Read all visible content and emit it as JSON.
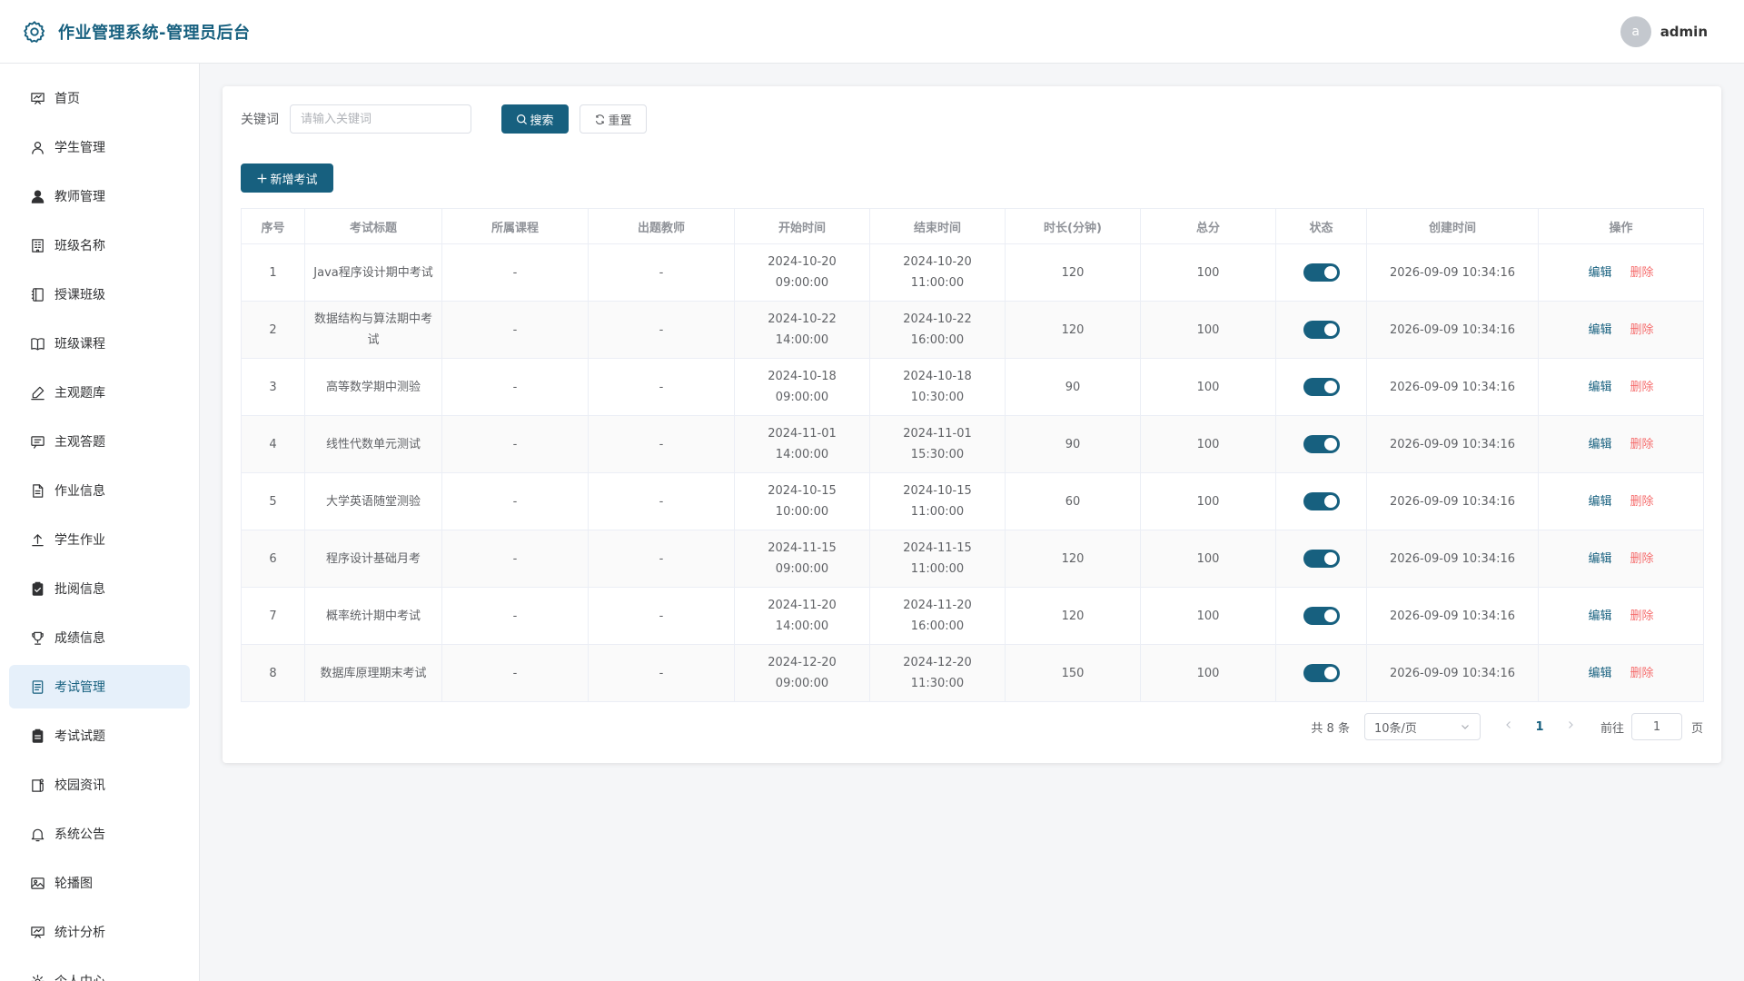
{
  "header": {
    "title": "作业管理系统-管理员后台",
    "avatar_letter": "a",
    "username": "admin"
  },
  "colors": {
    "primary": "#17607f",
    "danger": "#f56c6c",
    "active_bg": "#e6f0fa"
  },
  "sidebar": {
    "items": [
      {
        "label": "首页",
        "icon": "dashboard-icon"
      },
      {
        "label": "学生管理",
        "icon": "user-icon"
      },
      {
        "label": "教师管理",
        "icon": "teacher-icon"
      },
      {
        "label": "班级名称",
        "icon": "building-icon"
      },
      {
        "label": "授课班级",
        "icon": "notebook-icon"
      },
      {
        "label": "班级课程",
        "icon": "book-icon"
      },
      {
        "label": "主观题库",
        "icon": "edit-pen-icon"
      },
      {
        "label": "主观答题",
        "icon": "message-icon"
      },
      {
        "label": "作业信息",
        "icon": "document-icon"
      },
      {
        "label": "学生作业",
        "icon": "upload-icon"
      },
      {
        "label": "批阅信息",
        "icon": "clipboard-check-icon"
      },
      {
        "label": "成绩信息",
        "icon": "cup-icon"
      },
      {
        "label": "考试管理",
        "icon": "tickets-icon",
        "active": true
      },
      {
        "label": "考试试题",
        "icon": "clipboard-icon"
      },
      {
        "label": "校园资讯",
        "icon": "news-icon"
      },
      {
        "label": "系统公告",
        "icon": "bell-icon"
      },
      {
        "label": "轮播图",
        "icon": "picture-icon"
      },
      {
        "label": "统计分析",
        "icon": "chart-icon"
      },
      {
        "label": "个人中心",
        "icon": "setting-icon"
      }
    ]
  },
  "search": {
    "label": "关键词",
    "placeholder": "请输入关键词",
    "search_button": "搜索",
    "reset_button": "重置"
  },
  "add_button": "新增考试",
  "table": {
    "columns": [
      "序号",
      "考试标题",
      "所属课程",
      "出题教师",
      "开始时间",
      "结束时间",
      "时长(分钟)",
      "总分",
      "状态",
      "创建时间",
      "操作"
    ],
    "edit_label": "编辑",
    "delete_label": "删除",
    "rows": [
      {
        "no": "1",
        "title": "Java程序设计期中考试",
        "course": "-",
        "teacher": "-",
        "start_date": "2024-10-20",
        "start_time": "09:00:00",
        "end_date": "2024-10-20",
        "end_time": "11:00:00",
        "duration": "120",
        "score": "100",
        "status": true,
        "created": "2026-09-09 10:34:16"
      },
      {
        "no": "2",
        "title": "数据结构与算法期中考试",
        "course": "-",
        "teacher": "-",
        "start_date": "2024-10-22",
        "start_time": "14:00:00",
        "end_date": "2024-10-22",
        "end_time": "16:00:00",
        "duration": "120",
        "score": "100",
        "status": true,
        "created": "2026-09-09 10:34:16"
      },
      {
        "no": "3",
        "title": "高等数学期中测验",
        "course": "-",
        "teacher": "-",
        "start_date": "2024-10-18",
        "start_time": "09:00:00",
        "end_date": "2024-10-18",
        "end_time": "10:30:00",
        "duration": "90",
        "score": "100",
        "status": true,
        "created": "2026-09-09 10:34:16"
      },
      {
        "no": "4",
        "title": "线性代数单元测试",
        "course": "-",
        "teacher": "-",
        "start_date": "2024-11-01",
        "start_time": "14:00:00",
        "end_date": "2024-11-01",
        "end_time": "15:30:00",
        "duration": "90",
        "score": "100",
        "status": true,
        "created": "2026-09-09 10:34:16"
      },
      {
        "no": "5",
        "title": "大学英语随堂测验",
        "course": "-",
        "teacher": "-",
        "start_date": "2024-10-15",
        "start_time": "10:00:00",
        "end_date": "2024-10-15",
        "end_time": "11:00:00",
        "duration": "60",
        "score": "100",
        "status": true,
        "created": "2026-09-09 10:34:16"
      },
      {
        "no": "6",
        "title": "程序设计基础月考",
        "course": "-",
        "teacher": "-",
        "start_date": "2024-11-15",
        "start_time": "09:00:00",
        "end_date": "2024-11-15",
        "end_time": "11:00:00",
        "duration": "120",
        "score": "100",
        "status": true,
        "created": "2026-09-09 10:34:16"
      },
      {
        "no": "7",
        "title": "概率统计期中考试",
        "course": "-",
        "teacher": "-",
        "start_date": "2024-11-20",
        "start_time": "14:00:00",
        "end_date": "2024-11-20",
        "end_time": "16:00:00",
        "duration": "120",
        "score": "100",
        "status": true,
        "created": "2026-09-09 10:34:16"
      },
      {
        "no": "8",
        "title": "数据库原理期末考试",
        "course": "-",
        "teacher": "-",
        "start_date": "2024-12-20",
        "start_time": "09:00:00",
        "end_date": "2024-12-20",
        "end_time": "11:30:00",
        "duration": "150",
        "score": "100",
        "status": true,
        "created": "2026-09-09 10:34:16"
      }
    ]
  },
  "pagination": {
    "total_text": "共 8 条",
    "page_size": "10条/页",
    "current_page": "1",
    "goto_label": "前往",
    "goto_value": "1",
    "page_unit": "页"
  }
}
